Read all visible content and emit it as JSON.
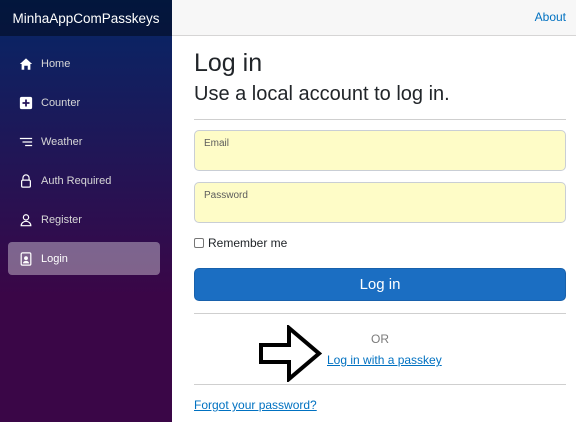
{
  "app": {
    "brand": "MinhaAppComPasskeys"
  },
  "sidebar": {
    "items": [
      {
        "label": "Home",
        "icon": "home-icon",
        "active": false
      },
      {
        "label": "Counter",
        "icon": "plus-square-icon",
        "active": false
      },
      {
        "label": "Weather",
        "icon": "list-icon",
        "active": false
      },
      {
        "label": "Auth Required",
        "icon": "lock-icon",
        "active": false
      },
      {
        "label": "Register",
        "icon": "person-icon",
        "active": false
      },
      {
        "label": "Login",
        "icon": "person-badge-icon",
        "active": true
      }
    ]
  },
  "topbar": {
    "about": "About"
  },
  "login": {
    "title": "Log in",
    "subtitle": "Use a local account to log in.",
    "email": {
      "label": "Email",
      "value": ""
    },
    "password": {
      "label": "Password",
      "value": ""
    },
    "remember_label": "Remember me",
    "remember_checked": false,
    "submit_label": "Log in",
    "or_text": "OR",
    "passkey_link": "Log in with a passkey",
    "forgot_link": "Forgot your password?"
  },
  "colors": {
    "accent": "#1b6ec2",
    "link": "#0071c1",
    "sidebar_top": "#052767",
    "sidebar_bottom": "#3a0647",
    "field_bg": "#fefcc7"
  }
}
